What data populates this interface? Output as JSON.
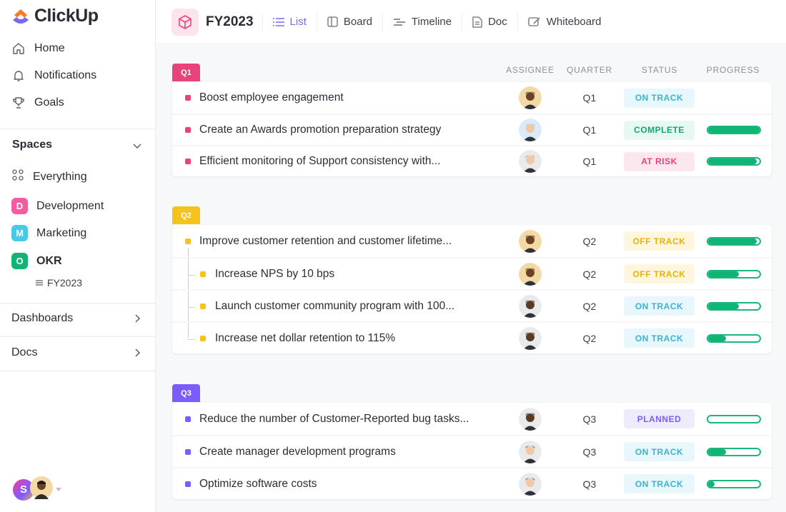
{
  "app": {
    "name": "ClickUp"
  },
  "sidebar": {
    "nav": [
      {
        "label": "Home",
        "icon": "home-icon"
      },
      {
        "label": "Notifications",
        "icon": "bell-icon"
      },
      {
        "label": "Goals",
        "icon": "trophy-icon"
      }
    ],
    "spaces_title": "Spaces",
    "everything_label": "Everything",
    "spaces": [
      {
        "letter": "D",
        "label": "Development",
        "color": "#f45ba0"
      },
      {
        "letter": "M",
        "label": "Marketing",
        "color": "#48c9e8"
      },
      {
        "letter": "O",
        "label": "OKR",
        "color": "#0fb574"
      }
    ],
    "okr_sub": "FY2023",
    "dashboards_label": "Dashboards",
    "docs_label": "Docs",
    "user_initial": "S"
  },
  "header": {
    "title": "FY2023",
    "tabs": [
      {
        "label": "List",
        "icon": "list-icon",
        "active": true
      },
      {
        "label": "Board",
        "icon": "board-icon"
      },
      {
        "label": "Timeline",
        "icon": "timeline-icon"
      },
      {
        "label": "Doc",
        "icon": "doc-icon"
      },
      {
        "label": "Whiteboard",
        "icon": "whiteboard-icon"
      }
    ]
  },
  "columns": {
    "assignee": "ASSIGNEE",
    "quarter": "QUARTER",
    "status": "STATUS",
    "progress": "PROGRESS"
  },
  "groups": [
    {
      "tag": "Q1",
      "color": "#e8437a",
      "tasks": [
        {
          "name": "Boost employee engagement",
          "quarter": "Q1",
          "status": "ON TRACK",
          "progress": null
        },
        {
          "name": "Create an Awards promotion preparation strategy",
          "quarter": "Q1",
          "status": "COMPLETE",
          "progress": 1.0
        },
        {
          "name": "Efficient monitoring of Support consistency with...",
          "quarter": "Q1",
          "status": "AT RISK",
          "progress": 0.95
        }
      ]
    },
    {
      "tag": "Q2",
      "color": "#f6c21c",
      "tasks": [
        {
          "name": "Improve customer retention and customer lifetime...",
          "quarter": "Q2",
          "status": "OFF TRACK",
          "progress": 0.95
        },
        {
          "name": "Increase NPS by 10 bps",
          "quarter": "Q2",
          "status": "OFF TRACK",
          "progress": 0.6
        },
        {
          "name": "Launch customer community program with 100...",
          "quarter": "Q2",
          "status": "ON TRACK",
          "progress": 0.6
        },
        {
          "name": "Increase net dollar retention to 115%",
          "quarter": "Q2",
          "status": "ON TRACK",
          "progress": 0.35
        }
      ]
    },
    {
      "tag": "Q3",
      "color": "#7b5cff",
      "tasks": [
        {
          "name": "Reduce the number of Customer-Reported bug tasks...",
          "quarter": "Q3",
          "status": "PLANNED",
          "progress": 0.0
        },
        {
          "name": "Create manager development programs",
          "quarter": "Q3",
          "status": "ON TRACK",
          "progress": 0.35
        },
        {
          "name": "Optimize software costs",
          "quarter": "Q3",
          "status": "ON TRACK",
          "progress": 0.12
        }
      ]
    }
  ],
  "status_colors": {
    "ON TRACK": {
      "bg": "#e7f7fb",
      "fg": "#3bb4d3"
    },
    "COMPLETE": {
      "bg": "#e6f8f1",
      "fg": "#14a672"
    },
    "AT RISK": {
      "bg": "#fde7ee",
      "fg": "#e8437a"
    },
    "OFF TRACK": {
      "bg": "#fef6dd",
      "fg": "#e9b20a"
    },
    "PLANNED": {
      "bg": "#eeebff",
      "fg": "#7b5cff"
    }
  }
}
